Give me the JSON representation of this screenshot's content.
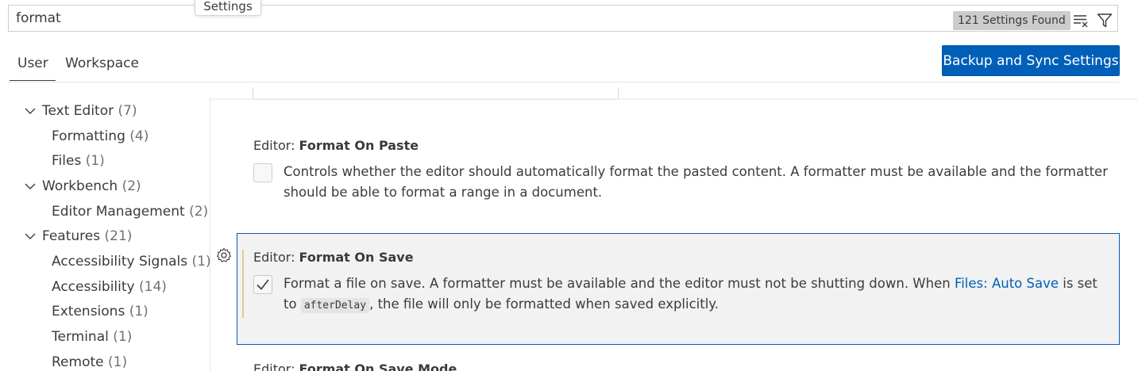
{
  "search": {
    "value": "format",
    "results_badge": "121 Settings Found",
    "clear_icon": "clear-filter-icon",
    "filter_icon": "filter-icon"
  },
  "tooltip": {
    "text": "Settings"
  },
  "tabs": [
    {
      "label": "User",
      "active": true
    },
    {
      "label": "Workspace",
      "active": false
    }
  ],
  "sync_button": {
    "label": "Backup and Sync Settings"
  },
  "toc": {
    "items": [
      {
        "label": "Text Editor",
        "count": "(7)",
        "expanded": true
      },
      {
        "label": "Formatting",
        "count": "(4)"
      },
      {
        "label": "Files",
        "count": "(1)"
      },
      {
        "label": "Workbench",
        "count": "(2)",
        "expanded": true
      },
      {
        "label": "Editor Management",
        "count": "(2)"
      },
      {
        "label": "Features",
        "count": "(21)",
        "expanded": true
      },
      {
        "label": "Accessibility Signals",
        "count": "(1)"
      },
      {
        "label": "Accessibility",
        "count": "(14)"
      },
      {
        "label": "Extensions",
        "count": "(1)"
      },
      {
        "label": "Terminal",
        "count": "(1)"
      },
      {
        "label": "Remote",
        "count": "(1)"
      }
    ]
  },
  "settings": {
    "format_on_paste": {
      "category": "Editor: ",
      "name": "Format On Paste",
      "checked": false,
      "desc_line1": "Controls whether the editor should automatically format the pasted content. A formatter must be available and the formatter",
      "desc_line2": "should be able to format a range in a document."
    },
    "format_on_save": {
      "category": "Editor: ",
      "name": "Format On Save",
      "checked": true,
      "desc_part1": "Format a file on save. A formatter must be available and the editor must not be shutting down. When ",
      "link": "Files: Auto Save",
      "desc_part2": " is set",
      "desc_line2_pre": "to ",
      "code": "afterDelay",
      "desc_line2_post": ", the file will only be formatted when saved explicitly."
    },
    "format_on_save_mode": {
      "category": "Editor: ",
      "name": "Format On Save Mode"
    }
  },
  "colors": {
    "accent": "#005fb8",
    "modified_indicator": "#e8c68a"
  }
}
